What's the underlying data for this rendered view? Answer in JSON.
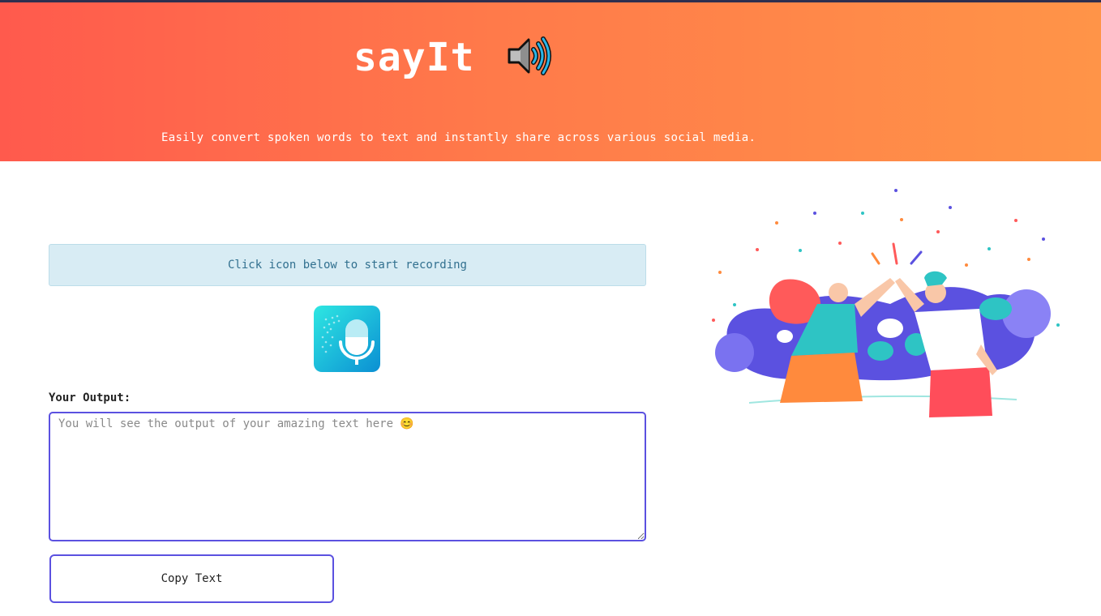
{
  "header": {
    "title": "sayIt",
    "speaker_icon": "speaker-high-volume-icon",
    "tagline": "Easily convert spoken words to text and instantly share across various social media."
  },
  "recorder": {
    "instruction": "Click icon below to start recording",
    "mic_icon": "microphone-icon"
  },
  "output": {
    "label": "Your Output:",
    "placeholder": "You will see the output of your amazing text here 😊",
    "value": ""
  },
  "actions": {
    "copy_label": "Copy Text"
  },
  "illustration": {
    "icon": "high-five-celebration-illustration"
  },
  "colors": {
    "hero_start": "#ff5a4d",
    "hero_end": "#ff9448",
    "accent": "#5b51e0",
    "banner_bg": "#d8ecf4",
    "banner_text": "#31708f"
  }
}
